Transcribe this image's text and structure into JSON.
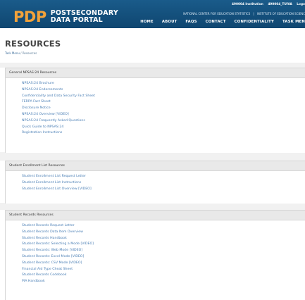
{
  "header": {
    "logo_mark": "PDP",
    "logo_line1": "POSTSECONDARY",
    "logo_line2": "DATA PORTAL",
    "utility": {
      "institution": "490004 Institution",
      "user": "490004_TUIVA",
      "login": "Logo"
    },
    "nces_line": {
      "center": "NATIONAL CENTER FOR EDUCATION STATISTICS",
      "separator": "|",
      "institute": "INSTITUTE OF EDUCATION SCIENC"
    },
    "nav": [
      {
        "label": "HOME"
      },
      {
        "label": "ABOUT"
      },
      {
        "label": "FAQS"
      },
      {
        "label": "CONTACT"
      },
      {
        "label": "CONFIDENTIALITY"
      },
      {
        "label": "TASK MEN"
      }
    ],
    "colors": {
      "bar": "#1a5b8a",
      "logo_mark": "#f2a23a"
    }
  },
  "page": {
    "title": "RESOURCES",
    "breadcrumb": {
      "home": "Task Menu",
      "separator": "/",
      "current": "Resources"
    }
  },
  "sections": [
    {
      "title": "General NPSAS:24 Resources",
      "links": [
        "NPSAS:24 Brochure",
        "NPSAS:24 Endorsements",
        "Confidentiality and Data Security Fact Sheet",
        "FERPA Fact Sheet",
        "Disclosure Notice",
        "NPSAS:24 Overview [VIDEO]",
        "NPSAS:24 Frequently Asked Questions",
        "Quick Guide to NPSAS:24",
        "Registration Instructions"
      ]
    },
    {
      "title": "Student Enrollment List Resources",
      "links": [
        "Student Enrollment List Request Letter",
        "Student Enrollment List Instructions",
        "Student Enrollment List Overview [VIDEO]"
      ]
    },
    {
      "title": "Student Records Resources",
      "links": [
        "Student Records Request Letter",
        "Student Records Data Item Overview",
        "Student Records Handbook",
        "Student Records: Selecting a Mode [VIDEO]",
        "Student Records: Web Mode [VIDEO]",
        "Student Records: Excel Mode [VIDEO]",
        "Student Records: CSV Mode [VIDEO]",
        "Financial Aid Type Cheat Sheet",
        "Student Records Codebook",
        "PIA Handbook"
      ]
    }
  ]
}
